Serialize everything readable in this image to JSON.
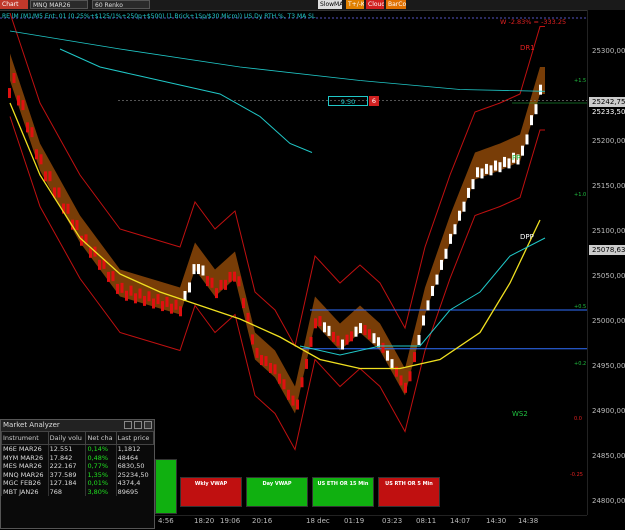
{
  "toolbar": {
    "chart_label": "Chart",
    "instrument": "MNQ MAR26",
    "interval": "60 Renko",
    "buttons": [
      "SlowMA",
      "T+/-K",
      "Cloud",
      "BarCol"
    ]
  },
  "indicator_label": "RE lM (M1/M5 Ent: 01 (0.25%+$125/1%+250p+$500) (1 Brick+1Sp/$30 Micro)) US Dy RTH %, T3 MA SL",
  "pnl_label": "W -2.83% = -333.25",
  "chart_labels": {
    "dr1": "DR1",
    "pp": "PP",
    "dpp": "DPP",
    "ws2": "WS2"
  },
  "order_box": {
    "qty": "9.50",
    "count": "6"
  },
  "price_axis": {
    "labels": [
      "25300,00",
      "25250,00",
      "25200,00",
      "25150,00",
      "25100,00",
      "25050,00",
      "25000,00",
      "24950,00",
      "24900,00",
      "24850,00",
      "24800,00"
    ],
    "tags": [
      {
        "text": "25242,75",
        "bg": "#cccccc",
        "fg": "#000000"
      },
      {
        "text": "25233,50",
        "bg": "#000000",
        "fg": "#ffffff"
      },
      {
        "text": "25078,63",
        "bg": "#cccccc",
        "fg": "#000000"
      }
    ]
  },
  "pct_labels": [
    "+1.5",
    "+1.0",
    "+0.5",
    "+0.2",
    "0.0",
    "-0.25"
  ],
  "time_axis": [
    "4:56",
    "18:20",
    "19:06",
    "20:16",
    "18 dec",
    "01:19",
    "03:23",
    "08:11",
    "14:07",
    "14:30",
    "14:38"
  ],
  "analyzer": {
    "title": "Market Analyzer",
    "columns": [
      "Instrument",
      "Daily volu",
      "Net cha",
      "Last price"
    ],
    "rows": [
      [
        "M6E MAR26",
        "12.551",
        "0,14%",
        "1,1812"
      ],
      [
        "MYM MAR26",
        "17.842",
        "0,48%",
        "48464"
      ],
      [
        "MES MAR26",
        "222.167",
        "0,77%",
        "6830,50"
      ],
      [
        "MNQ MAR26",
        "377.589",
        "1,35%",
        "25234,50"
      ],
      [
        "MGC FEB26",
        "127.184",
        "0,01%",
        "4374,4"
      ],
      [
        "MBT JAN26",
        "768",
        "3,80%",
        "89695"
      ]
    ]
  },
  "vwap_buttons": [
    "Wkly VWAP",
    "Day VWAP",
    "US ETH OR 15 Min",
    "US RTH OR 5 Min"
  ],
  "colors": {
    "up_brick": "#ffffff",
    "down_brick": "#e01010",
    "cloud_orange": "#a0520a",
    "yellow_ma": "#f0e020",
    "cyan_ma": "#20c8c8",
    "band_red": "#c01010",
    "level_blue": "#3070ff",
    "green_button": "#10b010",
    "red_button": "#c01010"
  }
}
